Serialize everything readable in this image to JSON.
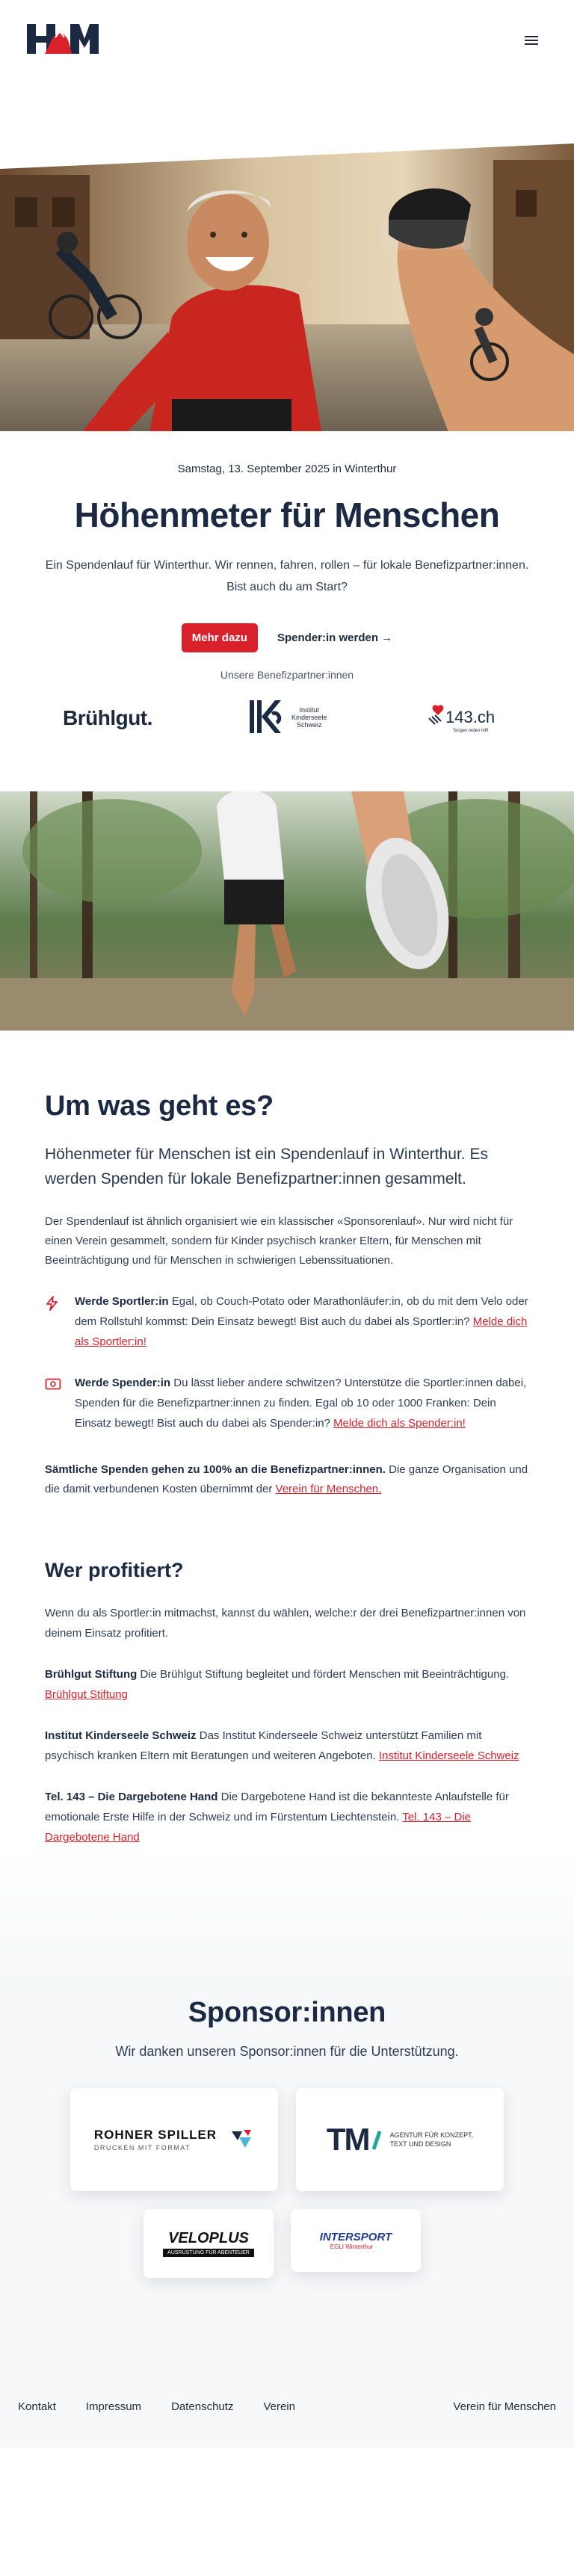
{
  "header": {
    "logo_text": "H&M",
    "menu_icon": "hamburger-icon"
  },
  "intro": {
    "date": "Samstag, 13. September 2025 in Winterthur",
    "title": "Höhenmeter für Menschen",
    "lead": "Ein Spendenlauf für Winterthur. Wir rennen, fahren, rollen – für lokale Benefizpartner:innen. Bist auch du am Start?",
    "cta_primary": "Mehr dazu",
    "cta_secondary": "Spender:in werden →",
    "partners_label": "Unsere Benefizpartner:innen",
    "partner_bruehl": "Brühlgut.",
    "partner_iks_line1": "Institut",
    "partner_iks_line2": "Kinderseele",
    "partner_iks_line3": "Schweiz",
    "partner_143": "143.ch",
    "partner_143_tag": "Sorgen reden hilft"
  },
  "about": {
    "heading": "Um was geht es?",
    "sub": "Höhenmeter für Menschen ist ein Spendenlauf in Winterthur. Es werden Spenden für lokale Benefizpartner:innen gesammelt.",
    "body": "Der Spendenlauf ist ähnlich organisiert wie ein klassischer «Sponsorenlauf». Nur wird nicht für einen Verein gesammelt, sondern für Kinder psychisch kranker Eltern, für Menschen mit Beeinträchtigung und für Menschen in schwierigen Lebenssituationen.",
    "f1_title": "Werde Sportler:in",
    "f1_text": " Egal, ob Couch-Potato oder Marathonläufer:in, ob du mit dem Velo oder dem Rollstuhl kommst: Dein Einsatz bewegt! Bist auch du dabei als Sportler:in? ",
    "f1_link": "Melde dich als Sportler:in!",
    "f2_title": "Werde Spender:in",
    "f2_text": " Du lässt lieber andere schwitzen? Unterstütze die Sportler:innen dabei, Spenden für die Benefizpartner:innen zu finden. Egal ob 10 oder 1000 Franken: Dein Einsatz bewegt! Bist auch du dabei als Spender:in? ",
    "f2_link": "Melde dich als Spender:in!",
    "note_title": "Sämtliche Spenden gehen zu 100% an die Benefizpartner:innen.",
    "note_text": " Die ganze Organisation und die damit verbundenen Kosten übernimmt der ",
    "note_link": "Verein für Menschen."
  },
  "benefit": {
    "heading": "Wer profitiert?",
    "intro": "Wenn du als Sportler:in mitmachst, kannst du wählen, welche:r der drei Benefizpartner:innen von deinem Einsatz profitiert.",
    "o1_title": "Brühlgut Stiftung",
    "o1_text": " Die Brühlgut Stiftung begleitet und fördert Menschen mit Beeinträchtigung. ",
    "o1_link": "Brühlgut Stiftung",
    "o2_title": "Institut Kinderseele Schweiz",
    "o2_text": " Das Institut Kinderseele Schweiz unterstützt Familien mit psychisch kranken Eltern mit Beratungen und weiteren Angeboten. ",
    "o2_link": "Institut Kinderseele Schweiz",
    "o3_title": "Tel. 143 – Die Dargebotene Hand",
    "o3_text": " Die Dargebotene Hand ist die bekannteste Anlaufstelle für emotionale Erste Hilfe in der Schweiz und im Fürstentum Liechtenstein. ",
    "o3_link": "Tel. 143 – Die Dargebotene Hand"
  },
  "sponsors": {
    "heading": "Sponsor:innen",
    "thanks": "Wir danken unseren Sponsor:innen für die Unterstützung.",
    "s1_name": "ROHNER SPILLER",
    "s1_tag": "DRUCKEN MIT FORMAT",
    "s2_name": "TM",
    "s2_tag1": "AGENTUR FÜR KONZEPT,",
    "s2_tag2": "TEXT UND DESIGN",
    "s3_name": "VELOPLUS",
    "s3_tag": "AUSRÜSTUNG FÜR ABENTEUER",
    "s4_name": "INTERSPORT",
    "s4_tag": "EGLI Winterthur"
  },
  "footer": {
    "links": [
      "Kontakt",
      "Impressum",
      "Datenschutz",
      "Verein"
    ],
    "right": "Verein für Menschen"
  },
  "colors": {
    "accent": "#d9212b",
    "navy": "#1b2a42"
  }
}
